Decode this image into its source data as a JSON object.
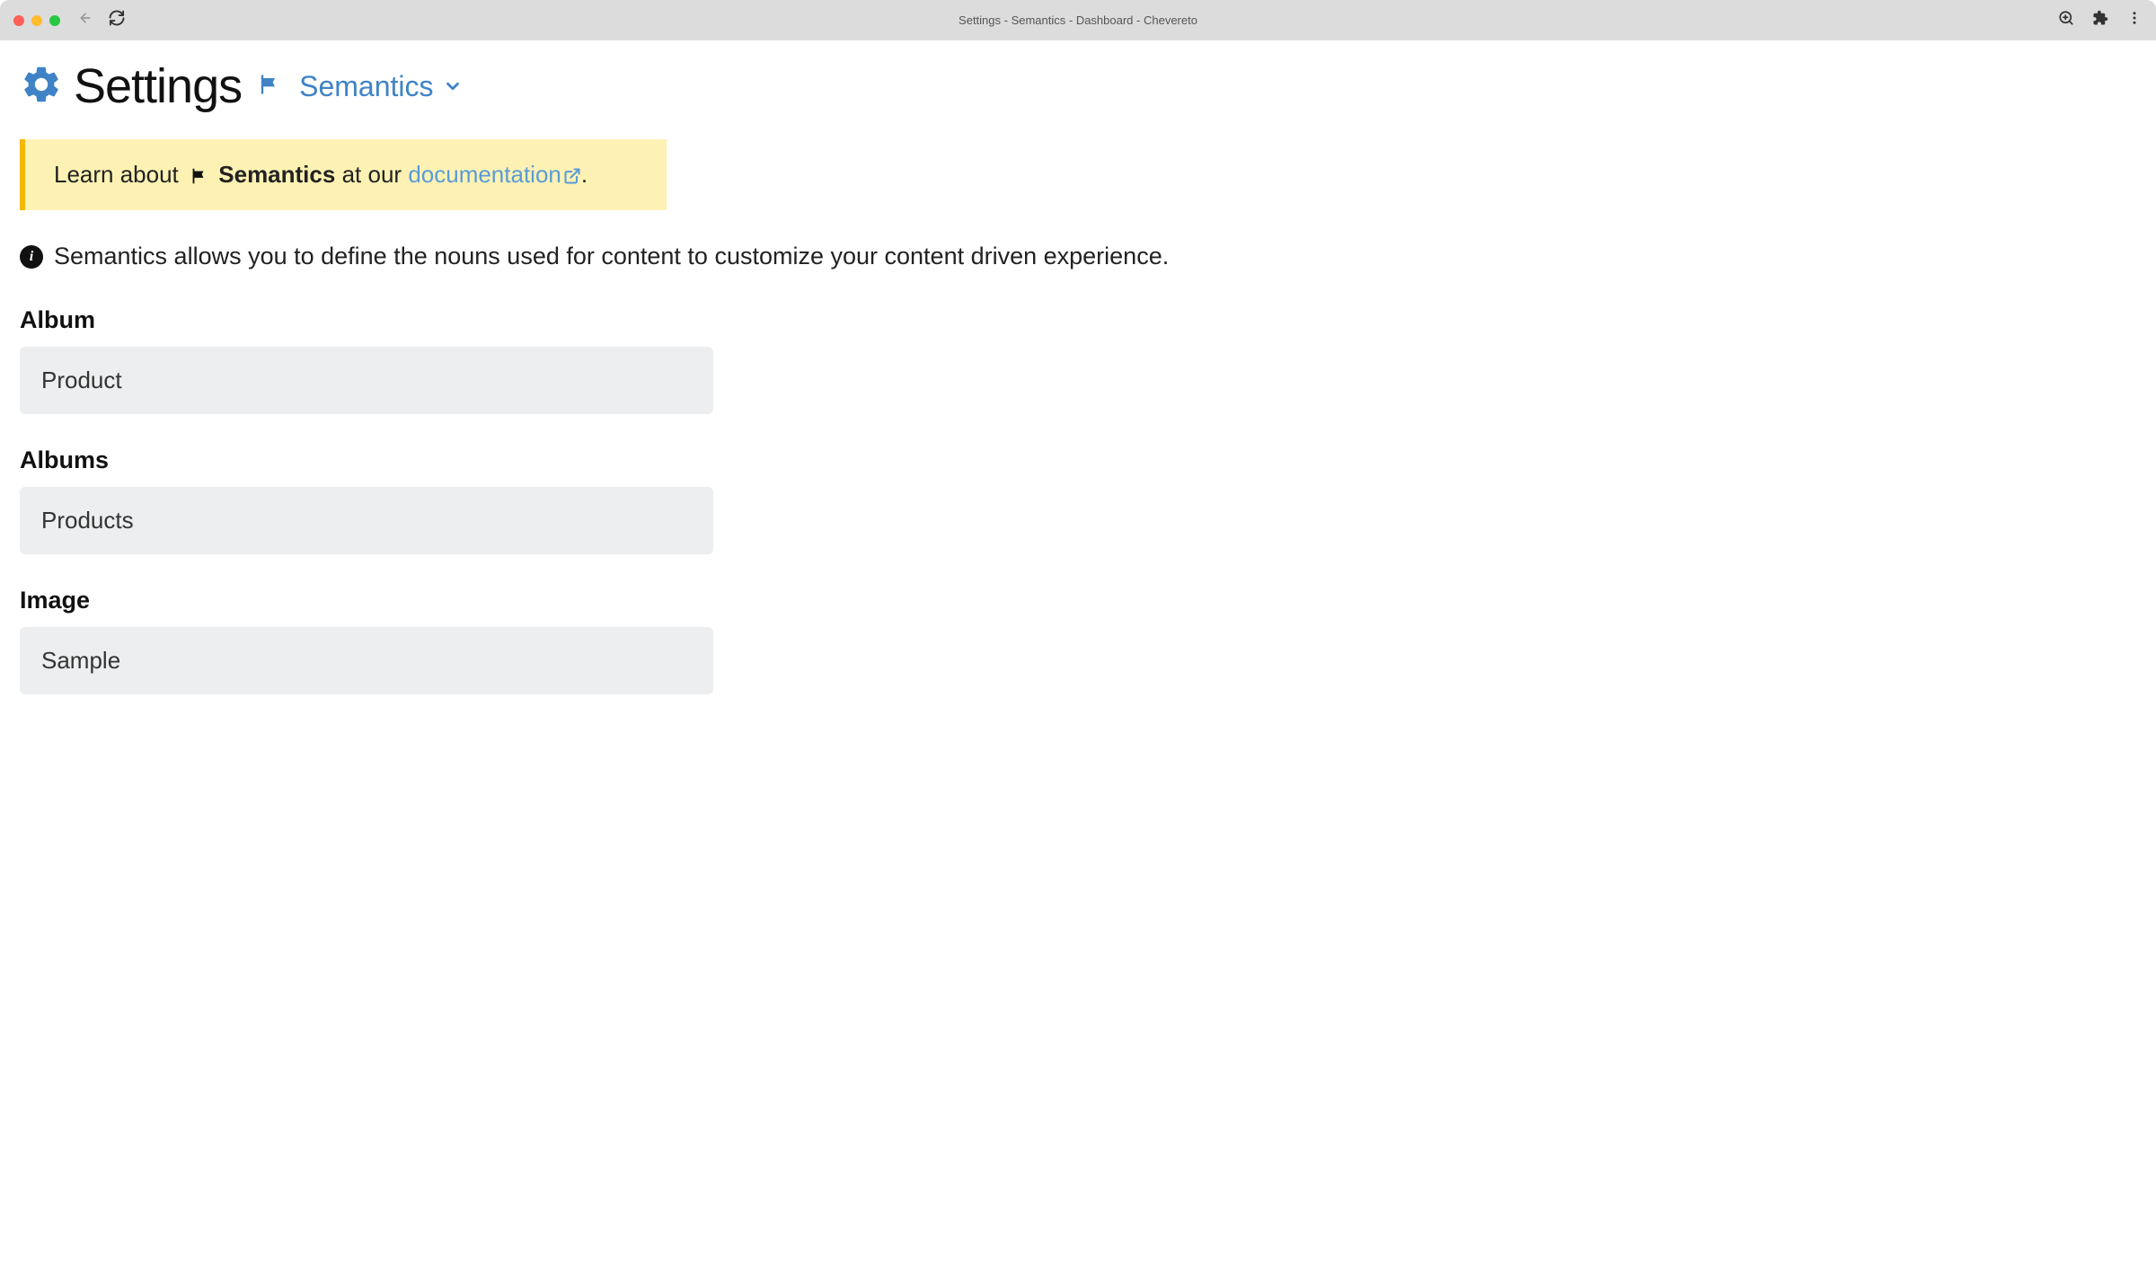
{
  "browser": {
    "tab_title": "Settings - Semantics - Dashboard - Chevereto"
  },
  "header": {
    "title": "Settings",
    "breadcrumb": "Semantics"
  },
  "banner": {
    "prefix": "Learn about",
    "subject": "Semantics",
    "middle": "at our",
    "link_text": "documentation",
    "suffix": "."
  },
  "description": "Semantics allows you to define the nouns used for content to customize your content driven experience.",
  "fields": [
    {
      "label": "Album",
      "value": "Product"
    },
    {
      "label": "Albums",
      "value": "Products"
    },
    {
      "label": "Image",
      "value": "Sample"
    }
  ]
}
